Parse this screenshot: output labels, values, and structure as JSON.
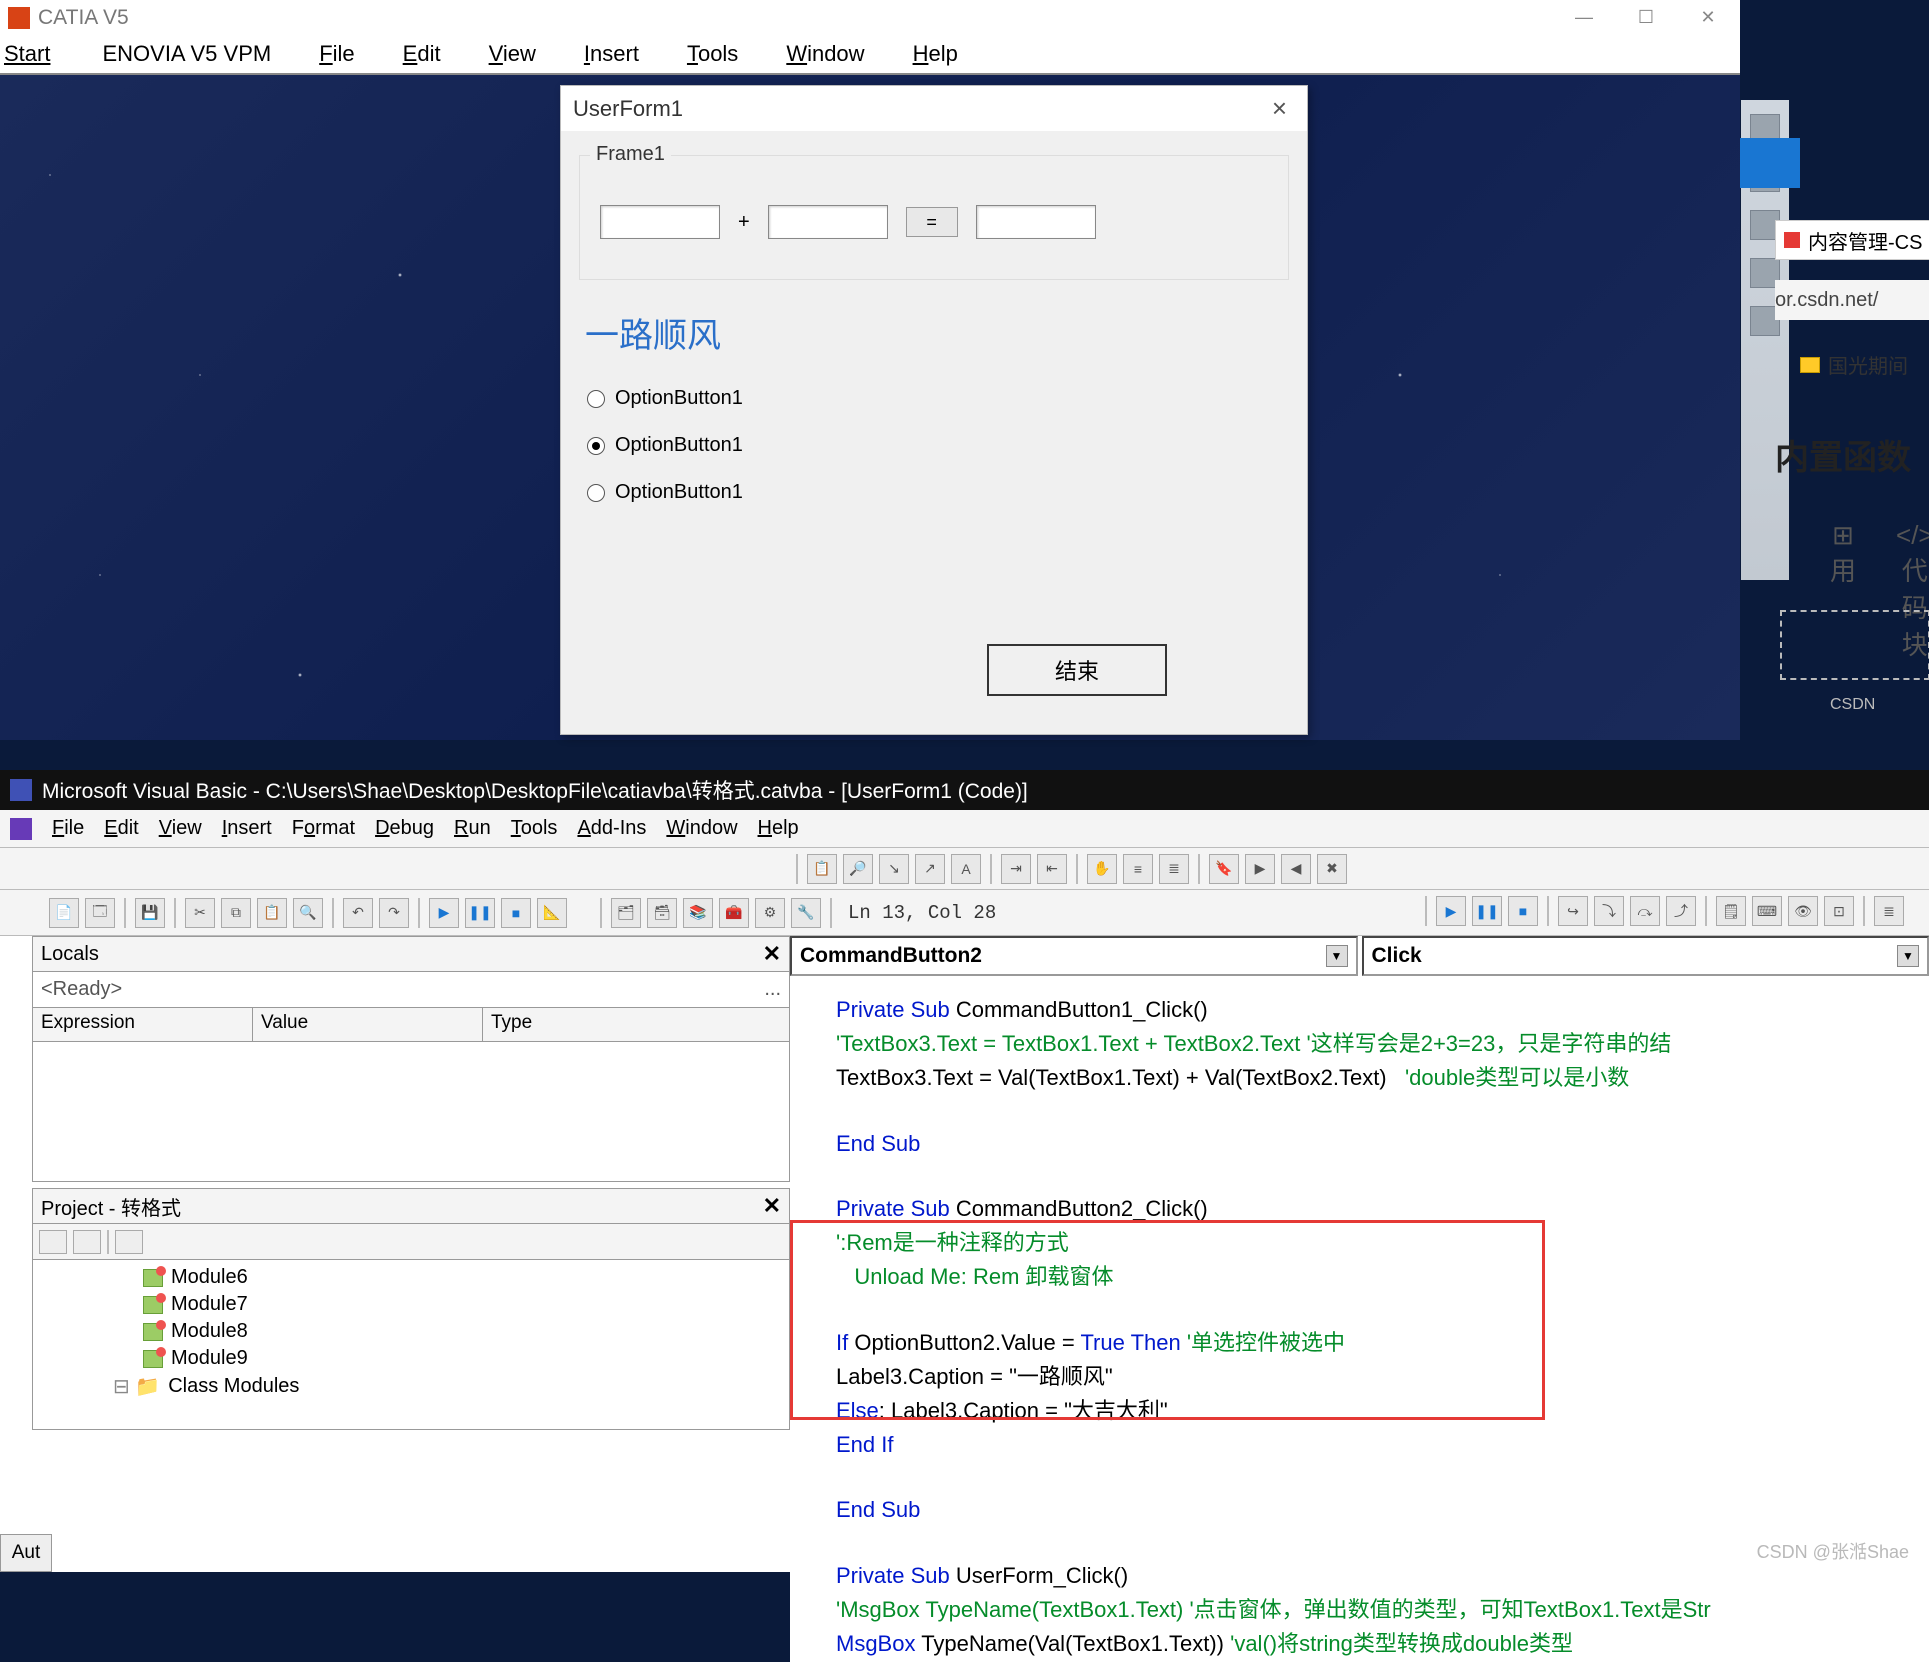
{
  "catia": {
    "title": "CATIA V5",
    "menu": [
      "Start",
      "ENOVIA V5 VPM",
      "File",
      "Edit",
      "View",
      "Insert",
      "Tools",
      "Window",
      "Help"
    ],
    "winbtns": [
      "—",
      "☐",
      "✕"
    ]
  },
  "userform": {
    "title": "UserForm1",
    "frame_label": "Frame1",
    "plus": "+",
    "equals": "=",
    "big_label": "一路顺风",
    "option1": "OptionButton1",
    "option2": "OptionButton1",
    "option3": "OptionButton1",
    "end_button": "结束"
  },
  "rightpeek": {
    "tab": "内容管理-CS",
    "addr": "or.csdn.net/",
    "folder": "国光期间",
    "heading": "内置函数",
    "chip1_icon": "</>",
    "chip1_label": "代码块",
    "chip0_label": "用",
    "csdn": "CSDN"
  },
  "vb": {
    "title": "Microsoft Visual Basic - C:\\Users\\Shae\\Desktop\\DesktopFile\\catiavba\\转格式.catvba - [UserForm1 (Code)]",
    "menu": [
      "File",
      "Edit",
      "View",
      "Insert",
      "Format",
      "Debug",
      "Run",
      "Tools",
      "Add-Ins",
      "Window",
      "Help"
    ],
    "lncol": "Ln 13, Col 28",
    "locals_title": "Locals",
    "ready": "<Ready>",
    "cols": [
      "Expression",
      "Value",
      "Type"
    ],
    "project_title": "Project - 转格式",
    "modules": [
      "Module6",
      "Module7",
      "Module8",
      "Module9",
      "Class Modules"
    ],
    "combo_obj": "CommandButton2",
    "combo_proc": "Click",
    "code": {
      "l1a": "Private Sub",
      "l1b": " CommandButton1_Click()",
      "l2": "'TextBox3.Text = TextBox1.Text + TextBox2.Text '这样写会是2+3=23，只是字符串的结",
      "l3a": "TextBox3.Text = Val(TextBox1.Text) + Val(TextBox2.Text)   ",
      "l3b": "'double类型可以是小数",
      "l4": "End Sub",
      "l5a": "Private Sub",
      "l5b": " CommandButton2_Click()",
      "l6": "':Rem是一种注释的方式",
      "l7": "   Unload Me: Rem 卸载窗体",
      "l8a": "If",
      "l8b": " OptionButton2.Value = ",
      "l8c": "True Then ",
      "l8d": "'单选控件被选中",
      "l9": "Label3.Caption = \"一路顺风\"",
      "l10a": "Else",
      "l10b": ": Label3.Caption = \"大吉大利\"",
      "l11": "End If",
      "l12": "End Sub",
      "l13a": "Private Sub",
      "l13b": " UserForm_Click()",
      "l14": "'MsgBox TypeName(TextBox1.Text) '点击窗体，弹出数值的类型，可知TextBox1.Text是Str",
      "l15a": "MsgBox",
      "l15b": " TypeName(Val(TextBox1.Text)) ",
      "l15c": "'val()将string类型转换成double类型"
    },
    "aut": "Aut",
    "watermark": "CSDN @张湉Shae"
  }
}
